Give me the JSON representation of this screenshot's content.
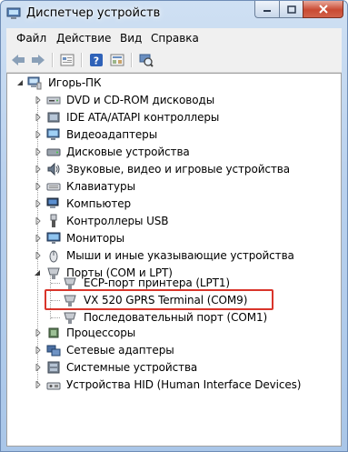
{
  "window": {
    "title": "Диспетчер устройств"
  },
  "menu": [
    {
      "label": "Файл"
    },
    {
      "label": "Действие"
    },
    {
      "label": "Вид"
    },
    {
      "label": "Справка"
    }
  ],
  "toolbar": [
    {
      "icon": "back-arrow-icon"
    },
    {
      "icon": "forward-arrow-icon"
    },
    {
      "icon": "properties-icon"
    },
    {
      "icon": "help-icon"
    },
    {
      "icon": "view-icon"
    },
    {
      "icon": "scan-hardware-icon"
    }
  ],
  "tree": {
    "root": {
      "label": "Игорь-ПК",
      "icon": "computer-icon",
      "expanded": true
    },
    "categories": [
      {
        "label": "DVD и CD-ROM дисководы",
        "icon": "dvd-drive-icon"
      },
      {
        "label": "IDE ATA/ATAPI контроллеры",
        "icon": "ide-controller-icon"
      },
      {
        "label": "Видеоадаптеры",
        "icon": "display-adapter-icon"
      },
      {
        "label": "Дисковые устройства",
        "icon": "disk-drive-icon"
      },
      {
        "label": "Звуковые, видео и игровые устройства",
        "icon": "sound-icon"
      },
      {
        "label": "Клавиатуры",
        "icon": "keyboard-icon"
      },
      {
        "label": "Компьютер",
        "icon": "computer-icon"
      },
      {
        "label": "Контроллеры USB",
        "icon": "usb-icon"
      },
      {
        "label": "Мониторы",
        "icon": "monitor-icon"
      },
      {
        "label": "Мыши и иные указывающие устройства",
        "icon": "mouse-icon"
      },
      {
        "label": "Порты (COM и LPT)",
        "icon": "port-icon",
        "expanded": true,
        "children": [
          {
            "label": "ECP-порт принтера (LPT1)",
            "icon": "port-icon"
          },
          {
            "label": "VX 520 GPRS Terminal  (COM9)",
            "icon": "port-icon",
            "highlighted": true
          },
          {
            "label": "Последовательный порт (COM1)",
            "icon": "port-icon"
          }
        ]
      },
      {
        "label": "Процессоры",
        "icon": "processor-icon"
      },
      {
        "label": "Сетевые адаптеры",
        "icon": "network-adapter-icon"
      },
      {
        "label": "Системные устройства",
        "icon": "system-device-icon"
      },
      {
        "label": "Устройства HID (Human Interface Devices)",
        "icon": "hid-icon"
      }
    ]
  },
  "colors": {
    "highlight_border": "#d9352b",
    "title_bar": "#b9d1ee",
    "close_button": "#c94a32"
  }
}
